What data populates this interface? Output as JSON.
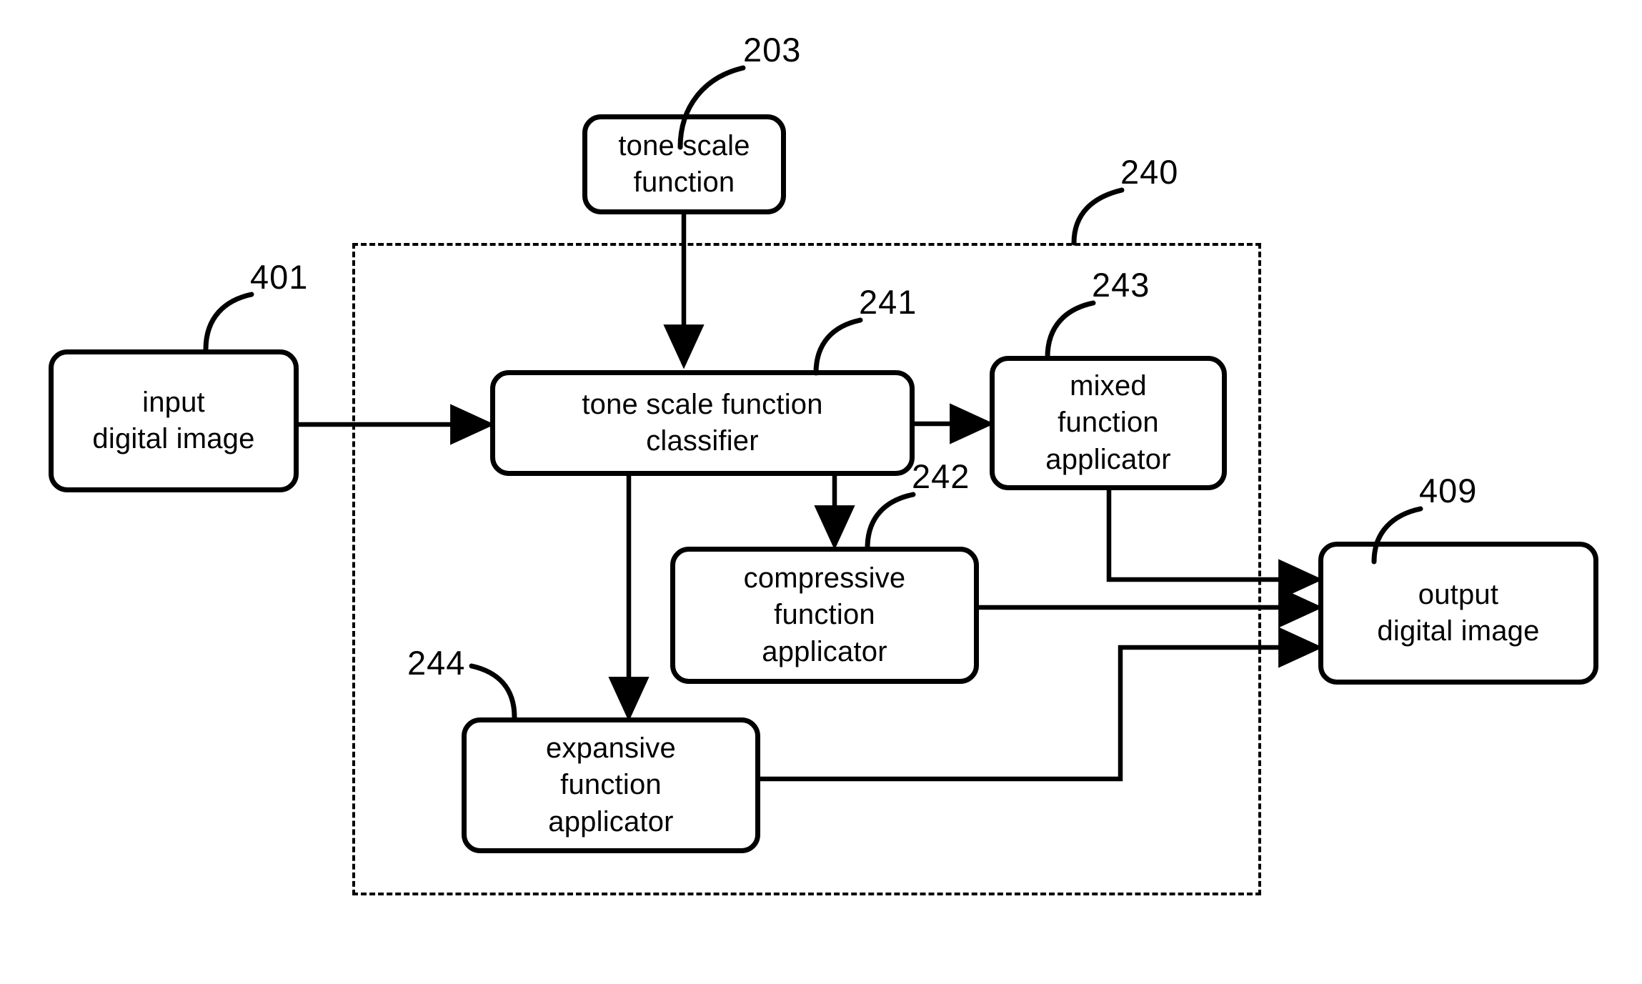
{
  "figure": {
    "type": "patent-block-diagram",
    "background_color": "#ffffff",
    "line_color": "#000000"
  },
  "dashed_group": {
    "ref": "240",
    "name": "tone-scale-processing-group"
  },
  "nodes": [
    {
      "id": "tone_scale_function",
      "ref": "203",
      "text": "tone scale\nfunction",
      "line1": "tone scale",
      "line2": "function",
      "line3": ""
    },
    {
      "id": "input_digital_image",
      "ref": "401",
      "text": "input\ndigital image",
      "line1": "input",
      "line2": "digital image",
      "line3": ""
    },
    {
      "id": "tone_scale_function_classifier",
      "ref": "241",
      "text": "tone scale function\nclassifier",
      "line1": "tone scale function",
      "line2": "classifier",
      "line3": ""
    },
    {
      "id": "mixed_function_applicator",
      "ref": "243",
      "text": "mixed\nfunction\napplicator",
      "line1": "mixed",
      "line2": "function",
      "line3": "applicator"
    },
    {
      "id": "compressive_function_applicator",
      "ref": "242",
      "text": "compressive\nfunction\napplicator",
      "line1": "compressive",
      "line2": "function",
      "line3": "applicator"
    },
    {
      "id": "expansive_function_applicator",
      "ref": "244",
      "text": "expansive\nfunction\napplicator",
      "line1": "expansive",
      "line2": "function",
      "line3": "applicator"
    },
    {
      "id": "output_digital_image",
      "ref": "409",
      "text": "output\ndigital image",
      "line1": "output",
      "line2": "digital image",
      "line3": ""
    }
  ],
  "reference_numerals": {
    "tone_scale_function": "203",
    "group": "240",
    "input_digital_image": "401",
    "classifier": "241",
    "compressive": "242",
    "mixed": "243",
    "expansive": "244",
    "output_digital_image": "409"
  },
  "edges": [
    {
      "from": "tone_scale_function",
      "to": "tone_scale_function_classifier",
      "arrow": true
    },
    {
      "from": "input_digital_image",
      "to": "tone_scale_function_classifier",
      "arrow": true
    },
    {
      "from": "tone_scale_function_classifier",
      "to": "mixed_function_applicator",
      "arrow": true
    },
    {
      "from": "tone_scale_function_classifier",
      "to": "compressive_function_applicator",
      "arrow": true
    },
    {
      "from": "tone_scale_function_classifier",
      "to": "expansive_function_applicator",
      "arrow": true
    },
    {
      "from": "mixed_function_applicator",
      "to": "output_digital_image",
      "arrow": true
    },
    {
      "from": "compressive_function_applicator",
      "to": "output_digital_image",
      "arrow": true
    },
    {
      "from": "expansive_function_applicator",
      "to": "output_digital_image",
      "arrow": true
    }
  ]
}
